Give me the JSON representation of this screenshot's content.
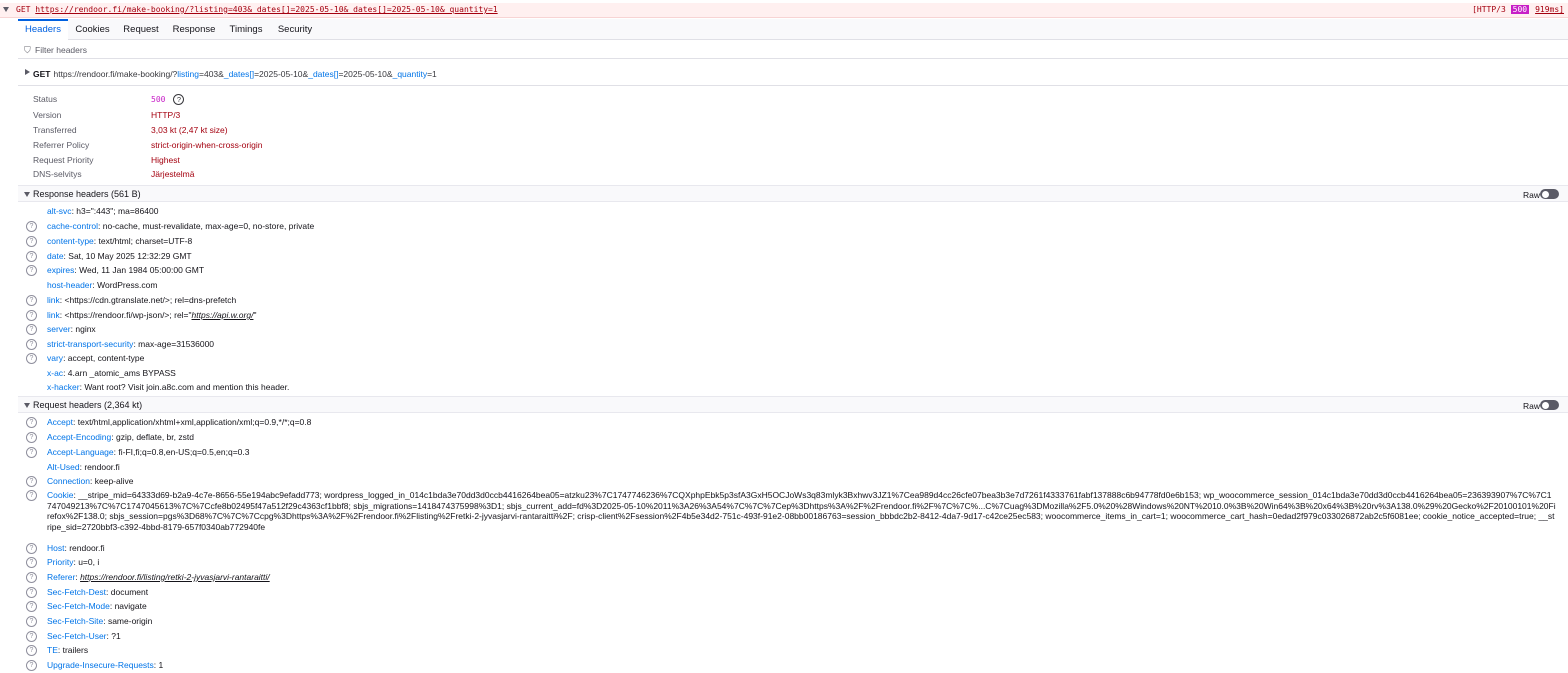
{
  "request": {
    "method": "GET",
    "url": "https://rendoor.fi/make-booking/?listing=403&_dates[]=2025-05-10&_dates[]=2025-05-10&_quantity=1",
    "protocol_prefix": "[HTTP/3",
    "status": "500",
    "time": "919ms]"
  },
  "tabs": [
    "Headers",
    "Cookies",
    "Request",
    "Response",
    "Timings",
    "Security"
  ],
  "filter": {
    "placeholder": "Filter headers"
  },
  "summary_url": {
    "method": "GET",
    "base": "https://rendoor.fi/make-booking/?",
    "p1_name": "listing",
    "p1_val": "=403&",
    "p2_name": "_dates[]",
    "p2_val": "=2025-05-10&",
    "p3_name": "_dates[]",
    "p3_val": "=2025-05-10&",
    "p4_name": "_quantity",
    "p4_val": "=1"
  },
  "summary": {
    "status": {
      "label": "Status",
      "value": "500"
    },
    "version": {
      "label": "Version",
      "value": "HTTP/3"
    },
    "transferred": {
      "label": "Transferred",
      "value": "3,03 kt (2,47 kt size)"
    },
    "referrer_policy": {
      "label": "Referrer Policy",
      "value": "strict-origin-when-cross-origin"
    },
    "request_priority": {
      "label": "Request Priority",
      "value": "Highest"
    },
    "dns": {
      "label": "DNS-selvitys",
      "value": "Järjestelmä"
    }
  },
  "response_headers": {
    "title": "Response headers (561 B)",
    "raw_label": "Raw",
    "items": [
      {
        "name": "alt-svc",
        "value": "h3=\":443\"; ma=86400"
      },
      {
        "name": "cache-control",
        "value": "no-cache, must-revalidate, max-age=0, no-store, private"
      },
      {
        "name": "content-type",
        "value": "text/html; charset=UTF-8"
      },
      {
        "name": "date",
        "value": "Sat, 10 May 2025 12:32:29 GMT"
      },
      {
        "name": "expires",
        "value": "Wed, 11 Jan 1984 05:00:00 GMT"
      },
      {
        "name": "host-header",
        "value": "WordPress.com"
      },
      {
        "name": "link",
        "value": "<https://cdn.gtranslate.net/>; rel=dns-prefetch"
      },
      {
        "name": "link",
        "value_pre": "<https://rendoor.fi/wp-json/>; rel=\"",
        "value_link": "https://api.w.org/",
        "value_post": "\""
      },
      {
        "name": "server",
        "value": "nginx"
      },
      {
        "name": "strict-transport-security",
        "value": "max-age=31536000"
      },
      {
        "name": "vary",
        "value": "accept, content-type"
      },
      {
        "name": "x-ac",
        "value": "4.arn _atomic_ams BYPASS"
      },
      {
        "name": "x-hacker",
        "value": "Want root? Visit join.a8c.com and mention this header."
      }
    ]
  },
  "request_headers": {
    "title": "Request headers (2,364 kt)",
    "raw_label": "Raw",
    "items": [
      {
        "name": "Accept",
        "value": "text/html,application/xhtml+xml,application/xml;q=0.9,*/*;q=0.8"
      },
      {
        "name": "Accept-Encoding",
        "value": "gzip, deflate, br, zstd"
      },
      {
        "name": "Accept-Language",
        "value": "fi-FI,fi;q=0.8,en-US;q=0.5,en;q=0.3"
      },
      {
        "name": "Alt-Used",
        "value": "rendoor.fi"
      },
      {
        "name": "Connection",
        "value": "keep-alive"
      },
      {
        "name": "Cookie",
        "value": "__stripe_mid=64333d69-b2a9-4c7e-8656-55e194abc9efadd773; wordpress_logged_in_014c1bda3e70dd3d0ccb4416264bea05=atzku23%7C1747746236%7CQXphpEbk5p3sfA3GxH5OCJoWs3q83mlyk3Bxhwv3JZ1%7Cea989d4cc26cfe07bea3b3e7d7261f4333761fabf137888c6b94778fd0e6b153; wp_woocommerce_session_014c1bda3e70dd3d0ccb4416264bea05=236393907%7C%7C1747049213%7C%7C1747045613%7C%7Ccfe8b02495f47a512f29c4363cf1bbf8; sbjs_migrations=1418474375998%3D1; sbjs_current_add=fd%3D2025-05-10%2011%3A26%3A54%7C%7C%7Cep%3Dhttps%3A%2F%2Frendoor.fi%2F%7C%7C%...C%7Cuag%3DMozilla%2F5.0%20%28Windows%20NT%2010.0%3B%20Win64%3B%20x64%3B%20rv%3A138.0%29%20Gecko%2F20100101%20Firefox%2F138.0; sbjs_session=pgs%3D68%7C%7C%7Ccpg%3Dhttps%3A%2F%2Frendoor.fi%2Flisting%2Fretki-2-jyvasjarvi-rantaraitti%2F; crisp-client%2Fsession%2F4b5e34d2-751c-493f-91e2-08bb00186763=session_bbbdc2b2-8412-4da7-9d17-c42ce25ec583; woocommerce_items_in_cart=1; woocommerce_cart_hash=0edad2f979c033026872ab2c5f6081ee; cookie_notice_accepted=true; __stripe_sid=2720bbf3-c392-4bbd-8179-657f0340ab772940fe"
      },
      {
        "name": "Host",
        "value": "rendoor.fi"
      },
      {
        "name": "Priority",
        "value": "u=0, i"
      },
      {
        "name": "Referer",
        "value_link": "https://rendoor.fi/listing/retki-2-jyvasjarvi-rantaraitti/"
      },
      {
        "name": "Sec-Fetch-Dest",
        "value": "document"
      },
      {
        "name": "Sec-Fetch-Mode",
        "value": "navigate"
      },
      {
        "name": "Sec-Fetch-Site",
        "value": "same-origin"
      },
      {
        "name": "Sec-Fetch-User",
        "value": "?1"
      },
      {
        "name": "TE",
        "value": "trailers"
      },
      {
        "name": "Upgrade-Insecure-Requests",
        "value": "1"
      }
    ]
  },
  "icons": {
    "help": "question-circle-icon",
    "filter": "funnel-icon"
  },
  "colors": {
    "accent": "#0061e0",
    "error": "#a4000f",
    "status_badge": "#c71ec7",
    "header_name": "#0074e8"
  }
}
